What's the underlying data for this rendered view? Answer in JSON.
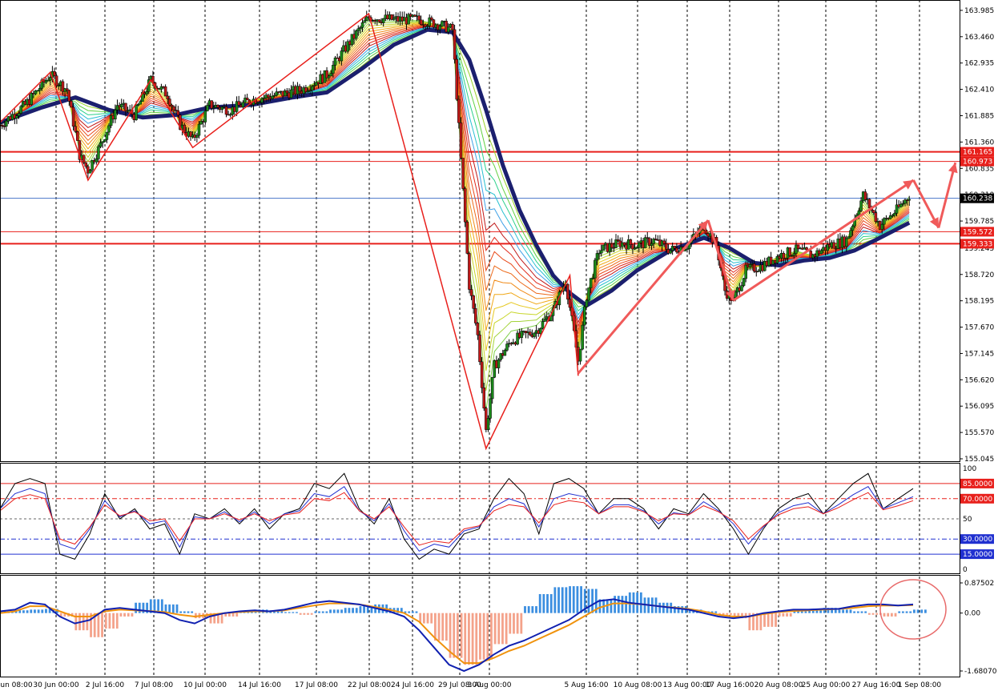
{
  "chart_data": [
    {
      "type": "candlestick",
      "panel": "price",
      "symbol": "USDJPY",
      "ylim": [
        155.045,
        164.0
      ],
      "y_ticks": [
        "163.985",
        "163.460",
        "162.935",
        "162.410",
        "161.885",
        "161.360",
        "160.835",
        "160.310",
        "159.785",
        "159.245",
        "158.720",
        "158.195",
        "157.670",
        "157.145",
        "156.620",
        "156.095",
        "155.570",
        "155.045"
      ],
      "x_ticks": [
        "28 Jun 08:00",
        "30 Jun 00:00",
        "2 Jul 16:00",
        "7 Jul 08:00",
        "10 Jul 00:00",
        "14 Jul 16:00",
        "17 Jul 08:00",
        "22 Jul 08:00",
        "24 Jul 16:00",
        "29 Jul 08:00",
        "3 Aug 00:00",
        "5 Aug 16:00",
        "10 Aug 08:00",
        "13 Aug 00:00",
        "17 Aug 16:00",
        "20 Aug 08:00",
        "25 Aug 00:00",
        "27 Aug 16:00",
        "1 Sep 08:00"
      ],
      "horizontal_levels": [
        {
          "value": 161.165,
          "label": "161.165",
          "color": "#e8201c",
          "style": "thick"
        },
        {
          "value": 160.973,
          "label": "160.973",
          "color": "#e8201c",
          "style": "thin"
        },
        {
          "value": 160.238,
          "label": "160.238",
          "color": "#4a76c8",
          "style": "current-price"
        },
        {
          "value": 159.572,
          "label": "159.572",
          "color": "#e8201c",
          "style": "thin"
        },
        {
          "value": 159.333,
          "label": "159.333",
          "color": "#e8201c",
          "style": "thick"
        }
      ],
      "current_price": 160.238,
      "zigzag": [
        {
          "t": 0,
          "v": 161.75
        },
        {
          "t": 12,
          "v": 162.75
        },
        {
          "t": 21,
          "v": 160.6
        },
        {
          "t": 36,
          "v": 162.6
        },
        {
          "t": 46,
          "v": 161.25
        },
        {
          "t": 88,
          "v": 163.92
        },
        {
          "t": 116,
          "v": 155.25
        },
        {
          "t": 136,
          "v": 158.7
        },
        {
          "t": 138,
          "v": 156.7
        }
      ],
      "price_path": [
        {
          "t": 0,
          "v": 161.7
        },
        {
          "t": 6,
          "v": 162.1
        },
        {
          "t": 12,
          "v": 162.7
        },
        {
          "t": 16,
          "v": 162.4
        },
        {
          "t": 19,
          "v": 161.1
        },
        {
          "t": 21,
          "v": 160.8
        },
        {
          "t": 24,
          "v": 161.3
        },
        {
          "t": 28,
          "v": 162.1
        },
        {
          "t": 32,
          "v": 161.9
        },
        {
          "t": 36,
          "v": 162.6
        },
        {
          "t": 40,
          "v": 162.3
        },
        {
          "t": 43,
          "v": 161.7
        },
        {
          "t": 46,
          "v": 161.4
        },
        {
          "t": 50,
          "v": 162.1
        },
        {
          "t": 55,
          "v": 162.0
        },
        {
          "t": 60,
          "v": 162.2
        },
        {
          "t": 66,
          "v": 162.3
        },
        {
          "t": 72,
          "v": 162.4
        },
        {
          "t": 78,
          "v": 162.7
        },
        {
          "t": 83,
          "v": 163.3
        },
        {
          "t": 88,
          "v": 163.85
        },
        {
          "t": 94,
          "v": 163.8
        },
        {
          "t": 100,
          "v": 163.8
        },
        {
          "t": 105,
          "v": 163.7
        },
        {
          "t": 108,
          "v": 163.6
        },
        {
          "t": 110,
          "v": 161.0
        },
        {
          "t": 112,
          "v": 158.5
        },
        {
          "t": 114,
          "v": 157.5
        },
        {
          "t": 116,
          "v": 155.6
        },
        {
          "t": 118,
          "v": 156.9
        },
        {
          "t": 122,
          "v": 157.4
        },
        {
          "t": 128,
          "v": 157.6
        },
        {
          "t": 132,
          "v": 158.0
        },
        {
          "t": 135,
          "v": 158.6
        },
        {
          "t": 138,
          "v": 157.0
        },
        {
          "t": 140,
          "v": 158.3
        },
        {
          "t": 143,
          "v": 159.2
        },
        {
          "t": 148,
          "v": 159.35
        },
        {
          "t": 152,
          "v": 159.3
        },
        {
          "t": 156,
          "v": 159.4
        },
        {
          "t": 160,
          "v": 159.2
        },
        {
          "t": 164,
          "v": 159.3
        },
        {
          "t": 168,
          "v": 159.7
        },
        {
          "t": 171,
          "v": 159.3
        },
        {
          "t": 173,
          "v": 158.4
        },
        {
          "t": 175,
          "v": 158.2
        },
        {
          "t": 178,
          "v": 158.8
        },
        {
          "t": 182,
          "v": 158.9
        },
        {
          "t": 186,
          "v": 159.1
        },
        {
          "t": 190,
          "v": 159.2
        },
        {
          "t": 194,
          "v": 159.1
        },
        {
          "t": 198,
          "v": 159.3
        },
        {
          "t": 202,
          "v": 159.4
        },
        {
          "t": 206,
          "v": 160.3
        },
        {
          "t": 210,
          "v": 159.7
        },
        {
          "t": 214,
          "v": 160.0
        },
        {
          "t": 217,
          "v": 160.3
        }
      ],
      "ma_thick": [
        {
          "t": 0,
          "v": 161.75
        },
        {
          "t": 10,
          "v": 162.05
        },
        {
          "t": 18,
          "v": 162.25
        },
        {
          "t": 26,
          "v": 162.0
        },
        {
          "t": 34,
          "v": 161.85
        },
        {
          "t": 42,
          "v": 161.9
        },
        {
          "t": 50,
          "v": 162.05
        },
        {
          "t": 60,
          "v": 162.1
        },
        {
          "t": 70,
          "v": 162.25
        },
        {
          "t": 78,
          "v": 162.35
        },
        {
          "t": 86,
          "v": 162.8
        },
        {
          "t": 94,
          "v": 163.3
        },
        {
          "t": 102,
          "v": 163.6
        },
        {
          "t": 108,
          "v": 163.55
        },
        {
          "t": 112,
          "v": 163.0
        },
        {
          "t": 116,
          "v": 162.0
        },
        {
          "t": 120,
          "v": 160.9
        },
        {
          "t": 124,
          "v": 160.0
        },
        {
          "t": 128,
          "v": 159.3
        },
        {
          "t": 132,
          "v": 158.7
        },
        {
          "t": 136,
          "v": 158.35
        },
        {
          "t": 140,
          "v": 158.1
        },
        {
          "t": 146,
          "v": 158.4
        },
        {
          "t": 152,
          "v": 158.8
        },
        {
          "t": 160,
          "v": 159.2
        },
        {
          "t": 168,
          "v": 159.45
        },
        {
          "t": 174,
          "v": 159.25
        },
        {
          "t": 180,
          "v": 158.95
        },
        {
          "t": 186,
          "v": 158.9
        },
        {
          "t": 192,
          "v": 159.0
        },
        {
          "t": 198,
          "v": 159.05
        },
        {
          "t": 204,
          "v": 159.2
        },
        {
          "t": 210,
          "v": 159.45
        },
        {
          "t": 217,
          "v": 159.75
        }
      ],
      "arrows": [
        {
          "from": {
            "t": 138,
            "v": 156.75
          },
          "to": {
            "t": 169,
            "v": 159.8
          }
        },
        {
          "from": {
            "t": 169,
            "v": 159.8
          },
          "to": {
            "t": 175,
            "v": 158.2
          }
        },
        {
          "from": {
            "t": 175,
            "v": 158.2
          },
          "to": {
            "t": 218,
            "v": 160.6
          }
        },
        {
          "from": {
            "t": 218,
            "v": 160.6
          },
          "to": {
            "t": 224,
            "v": 159.65
          }
        },
        {
          "from": {
            "t": 224,
            "v": 159.65
          },
          "to": {
            "t": 228,
            "v": 160.95
          }
        }
      ]
    },
    {
      "type": "line",
      "panel": "oscillator",
      "ylim": [
        0,
        100
      ],
      "y_ticks": [
        "100",
        "50",
        "0"
      ],
      "levels": [
        {
          "value": 85,
          "label": "85.0000",
          "color": "#e8201c"
        },
        {
          "value": 70,
          "label": "70.0000",
          "color": "#e8201c"
        },
        {
          "value": 30,
          "label": "30.0000",
          "color": "#2030d0"
        },
        {
          "value": 15,
          "label": "15.0000",
          "color": "#2030d0"
        }
      ],
      "series": [
        {
          "color": "#000000",
          "values": [
            60,
            85,
            90,
            85,
            15,
            10,
            35,
            75,
            50,
            60,
            40,
            45,
            15,
            55,
            50,
            60,
            45,
            60,
            40,
            55,
            60,
            85,
            80,
            95,
            60,
            45,
            70,
            30,
            10,
            20,
            15,
            35,
            40,
            70,
            90,
            75,
            35,
            85,
            90,
            80,
            55,
            70,
            70,
            60,
            40,
            60,
            55,
            75,
            60,
            40,
            15,
            40,
            60,
            70,
            75,
            55,
            70,
            85,
            95,
            60,
            70,
            80
          ]
        },
        {
          "color": "#2030d0",
          "values": [
            60,
            75,
            80,
            75,
            25,
            20,
            40,
            68,
            52,
            58,
            45,
            48,
            22,
            52,
            50,
            57,
            47,
            57,
            45,
            55,
            58,
            75,
            72,
            82,
            58,
            48,
            65,
            38,
            18,
            25,
            22,
            38,
            42,
            62,
            70,
            65,
            42,
            70,
            75,
            72,
            55,
            64,
            64,
            58,
            45,
            56,
            54,
            67,
            58,
            45,
            25,
            42,
            56,
            63,
            66,
            55,
            64,
            74,
            82,
            60,
            66,
            72
          ]
        },
        {
          "color": "#e8201c",
          "values": [
            58,
            70,
            74,
            70,
            30,
            25,
            42,
            64,
            53,
            57,
            48,
            50,
            28,
            50,
            50,
            55,
            49,
            55,
            48,
            54,
            56,
            70,
            68,
            76,
            58,
            50,
            62,
            42,
            24,
            28,
            26,
            40,
            43,
            58,
            64,
            62,
            46,
            64,
            68,
            66,
            55,
            62,
            62,
            57,
            48,
            55,
            54,
            63,
            57,
            48,
            30,
            43,
            54,
            60,
            62,
            55,
            61,
            69,
            76,
            59,
            63,
            68
          ]
        }
      ]
    },
    {
      "type": "bar",
      "panel": "macd",
      "ylim": [
        -1.6807,
        0.87502
      ],
      "y_ticks": [
        "0.87502",
        "0.00",
        "-1.68070"
      ],
      "histogram_positive_color": "#3b8ee0",
      "histogram_negative_color": "#f4a28a",
      "histogram": [
        0.05,
        0.08,
        0.1,
        0.12,
        -0.1,
        -0.5,
        -0.7,
        -0.45,
        -0.1,
        0.3,
        0.4,
        0.25,
        0.05,
        -0.15,
        -0.3,
        -0.1,
        0.05,
        0.1,
        0.08,
        0.03,
        -0.05,
        0.05,
        0.1,
        0.15,
        0.2,
        0.25,
        0.15,
        0.05,
        -0.3,
        -0.8,
        -1.3,
        -1.5,
        -1.35,
        -0.9,
        -0.6,
        0.2,
        0.55,
        0.75,
        0.78,
        0.7,
        0.4,
        0.5,
        0.6,
        0.45,
        0.3,
        0.2,
        0.1,
        0.05,
        -0.05,
        -0.15,
        -0.5,
        -0.4,
        -0.1,
        0.05,
        0.1,
        0.15,
        0.1,
        0.05,
        -0.05,
        -0.1,
        0.05,
        0.1
      ],
      "macd_line": [
        0.05,
        0.1,
        0.3,
        0.25,
        -0.1,
        -0.3,
        -0.2,
        0.1,
        0.15,
        0.1,
        0.05,
        0.0,
        -0.2,
        -0.3,
        -0.1,
        0.0,
        0.05,
        0.08,
        0.05,
        0.1,
        0.2,
        0.3,
        0.35,
        0.3,
        0.25,
        0.15,
        0.05,
        -0.1,
        -0.5,
        -1.0,
        -1.5,
        -1.68,
        -1.5,
        -1.2,
        -0.95,
        -0.8,
        -0.6,
        -0.4,
        -0.2,
        0.1,
        0.35,
        0.4,
        0.3,
        0.25,
        0.2,
        0.15,
        0.1,
        0.0,
        -0.1,
        -0.15,
        -0.1,
        0.0,
        0.05,
        0.1,
        0.1,
        0.12,
        0.12,
        0.2,
        0.25,
        0.25,
        0.22,
        0.25
      ],
      "signal_line": [
        0.0,
        0.05,
        0.2,
        0.2,
        0.05,
        -0.1,
        -0.1,
        0.05,
        0.1,
        0.08,
        0.06,
        0.03,
        -0.05,
        -0.1,
        -0.05,
        0.0,
        0.03,
        0.05,
        0.05,
        0.08,
        0.15,
        0.22,
        0.28,
        0.28,
        0.25,
        0.18,
        0.1,
        0.0,
        -0.25,
        -0.7,
        -1.1,
        -1.45,
        -1.45,
        -1.3,
        -1.1,
        -0.95,
        -0.75,
        -0.55,
        -0.35,
        -0.1,
        0.15,
        0.28,
        0.28,
        0.25,
        0.2,
        0.16,
        0.12,
        0.05,
        -0.05,
        -0.1,
        -0.1,
        -0.03,
        0.03,
        0.06,
        0.08,
        0.1,
        0.12,
        0.15,
        0.2,
        0.22,
        0.22,
        0.23
      ]
    }
  ]
}
